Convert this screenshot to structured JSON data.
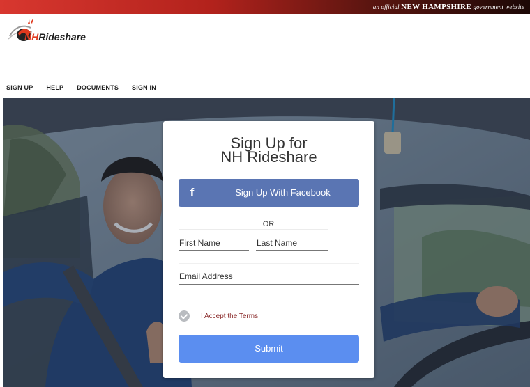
{
  "gov_banner": {
    "prefix": "an official",
    "state": "NEW HAMPSHIRE",
    "suffix": "government website"
  },
  "logo": {
    "nh": "NH",
    "rideshare": "Rideshare"
  },
  "nav": {
    "items": [
      "SIGN UP",
      "HELP",
      "DOCUMENTS",
      "SIGN IN"
    ]
  },
  "form": {
    "title_line1": "Sign Up for",
    "title_line2": "NH Rideshare",
    "facebook_icon": "f",
    "facebook_label": "Sign Up With Facebook",
    "or_text": "OR",
    "first_name_placeholder": "First Name",
    "last_name_placeholder": "Last Name",
    "email_placeholder": "Email Address",
    "terms_label": "I Accept the Terms",
    "terms_checked": true,
    "submit_label": "Submit"
  },
  "colors": {
    "facebook": "#5a75b3",
    "submit": "#5b8ef0",
    "gov_bar": "#b2221c",
    "terms_text": "#8a2a2a"
  },
  "icons": [
    "facebook-icon",
    "checkmark-icon",
    "rideshare-logo-icon"
  ]
}
